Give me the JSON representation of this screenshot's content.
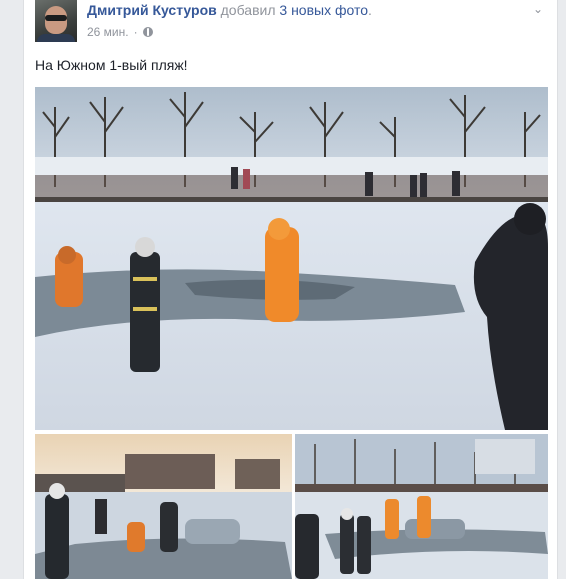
{
  "post": {
    "author": "Дмитрий Кустуров",
    "action": "добавил",
    "action_link": "3 новых фото",
    "action_end": ".",
    "time": "26 мин.",
    "separator": "·",
    "text": "На Южном 1-вый пляж!",
    "chevron": "⌄"
  },
  "icons": {
    "avatar": "user-avatar",
    "privacy": "globe-icon",
    "menu": "chevron-down-icon"
  },
  "colors": {
    "link": "#365899",
    "meta": "#90949c",
    "text": "#1d2129",
    "background": "#e9ebee"
  }
}
